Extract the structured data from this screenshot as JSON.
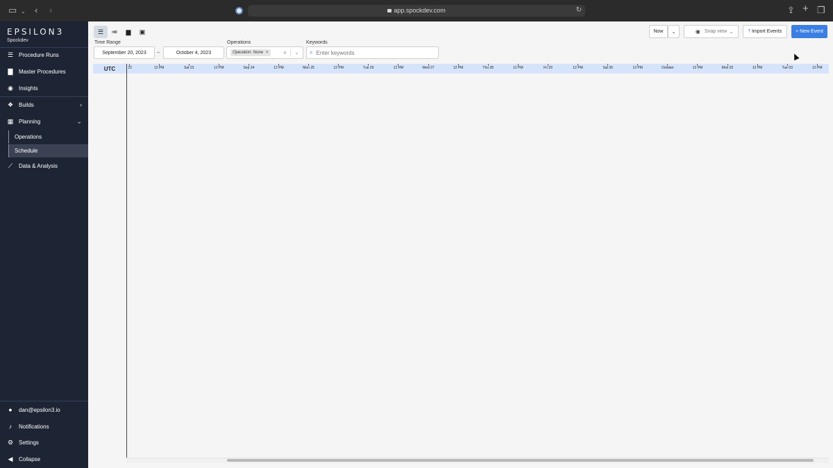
{
  "browser": {
    "url": "app.spockdev.com"
  },
  "sidebar": {
    "logo": "EPSILON3",
    "org": "Spockdev",
    "items": [
      {
        "label": "Procedure Runs",
        "icon": "list-icon"
      },
      {
        "label": "Master Procedures",
        "icon": "document-icon"
      },
      {
        "label": "Insights",
        "icon": "eye-icon"
      },
      {
        "label": "Builds",
        "icon": "cubes-icon"
      },
      {
        "label": "Planning",
        "icon": "calendar-icon"
      },
      {
        "label": "Data & Analysis",
        "icon": "chart-line-icon"
      }
    ],
    "planning_sub": [
      {
        "label": "Operations"
      },
      {
        "label": "Schedule"
      }
    ],
    "footer": [
      {
        "label": "dan@epsilon3.io",
        "icon": "user-icon"
      },
      {
        "label": "Notifications",
        "icon": "bell-icon"
      },
      {
        "label": "Settings",
        "icon": "gear-icon"
      },
      {
        "label": "Collapse",
        "icon": "collapse-icon"
      }
    ]
  },
  "toolbar": {
    "time_range_label": "Time Range",
    "start_date": "September 20, 2023",
    "end_date": "October 4, 2023",
    "operations_label": "Operations",
    "operation_chip": "Operation: None",
    "keywords_label": "Keywords",
    "keywords_placeholder": "Enter keywords",
    "now_label": "Now",
    "snap_view_label": "Snap view",
    "import_label": "Import Events",
    "new_event_label": "+ New Event"
  },
  "timeline": {
    "timezone": "UTC",
    "ticks": [
      "i 22",
      "12 PM",
      "Sat 23",
      "12 PM",
      "Sep 24",
      "12 PM",
      "Mon 25",
      "12 PM",
      "Tue 26",
      "12 PM",
      "Wed 27",
      "12 PM",
      "Thu 28",
      "12 PM",
      "Fri 29",
      "12 PM",
      "Sat 30",
      "12 PM",
      "October",
      "12 PM",
      "Mon 02",
      "12 PM",
      "Tue 03",
      "12 PM"
    ]
  },
  "colors": {
    "sidebar_bg": "#1d2433",
    "accent": "#3b7fe3",
    "timeline_header": "#d6e4fb"
  }
}
